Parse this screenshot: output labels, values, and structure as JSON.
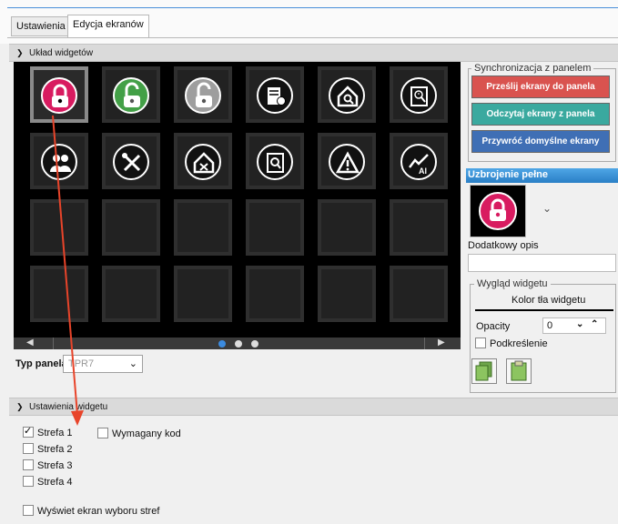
{
  "tabs": [
    {
      "label": "Ustawienia",
      "active": false
    },
    {
      "label": "Edycja ekranów",
      "active": true
    }
  ],
  "layout_section": {
    "title": "Układ widgetów",
    "collapse_icon": "double-chevron-down-icon"
  },
  "widgets": [
    {
      "icon": "padlock-icon",
      "bg": "#d81b60",
      "selected": true
    },
    {
      "icon": "padlock-open-icon",
      "bg": "#43a047",
      "selected": false
    },
    {
      "icon": "padlock-open-icon",
      "bg": "#9e9e9e",
      "selected": false
    },
    {
      "icon": "document-lightbulb-icon",
      "bg": "#111",
      "selected": false
    },
    {
      "icon": "house-search-icon",
      "bg": "#111",
      "selected": false
    },
    {
      "icon": "document-clock-icon",
      "bg": "#111",
      "selected": false
    },
    {
      "icon": "users-icon",
      "bg": "#111",
      "selected": false
    },
    {
      "icon": "tools-icon",
      "bg": "#111",
      "selected": false
    },
    {
      "icon": "house-x-icon",
      "bg": "#111",
      "selected": false
    },
    {
      "icon": "document-search-icon",
      "bg": "#111",
      "selected": false
    },
    {
      "icon": "warning-icon",
      "bg": "#111",
      "selected": false
    },
    {
      "icon": "chart-ai-icon",
      "bg": "#111",
      "selected": false
    }
  ],
  "grid_empty_cells": 12,
  "pager": {
    "prev_icon": "triangle-left-icon",
    "next_icon": "triangle-right-icon",
    "pages": 3
  },
  "panel_type": {
    "label": "Typ panela",
    "value": "TPR7"
  },
  "sync": {
    "legend": "Synchronizacja z panelem",
    "send_label": "Prześlij ekrany do panela",
    "read_label": "Odczytaj ekrany z panela",
    "restore_label": "Przywróć domyślne ekrany",
    "send_color": "#d9534f",
    "read_color": "#3aa99f",
    "restore_color": "#3f6fb5"
  },
  "selected_widget": {
    "title": "Uzbrojenie pełne",
    "icon": "padlock-icon",
    "extra_label": "Dodatkowy opis",
    "extra_value": ""
  },
  "appearance": {
    "legend": "Wygląd widgetu",
    "bg_color_label": "Kolor tła widgetu",
    "opacity_label": "Opacity",
    "opacity_value": "0",
    "underline_label": "Podkreślenie",
    "copy_icon": "copy-icon",
    "paste_icon": "clipboard-icon"
  },
  "widget_settings": {
    "title": "Ustawienia widgetu"
  },
  "zones": [
    {
      "label": "Strefa 1",
      "checked": true
    },
    {
      "label": "Strefa 2",
      "checked": false
    },
    {
      "label": "Strefa 3",
      "checked": false
    },
    {
      "label": "Strefa 4",
      "checked": false
    }
  ],
  "require_code_label": "Wymagany kod",
  "show_zone_screen_label": "Wyświet ekran wyboru stref",
  "annotation_color": "#e8442a"
}
